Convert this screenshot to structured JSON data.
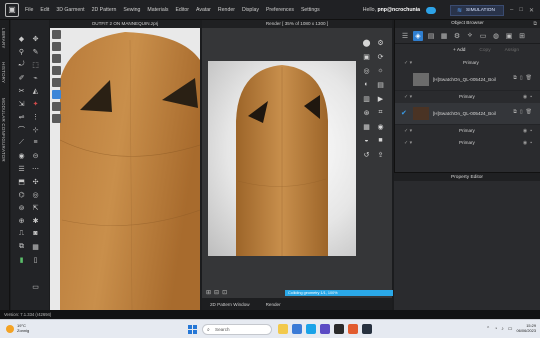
{
  "menubar": {
    "items": [
      "File",
      "Edit",
      "3D Garment",
      "2D Pattern",
      "Sewing",
      "Materials",
      "Editor",
      "Avatar",
      "Render",
      "Display",
      "Preferences",
      "Settings"
    ],
    "greeting_prefix": "Hello, ",
    "username": "pnp@ncrochunia",
    "simulation_label": "SIMULATION"
  },
  "side_tabs": [
    "LIBRARY",
    "HISTORY",
    "MODULAR CONFIGURATOR"
  ],
  "viewport3d": {
    "title": "OUTFIT 2 ON MANNEQUIN.zprj"
  },
  "render": {
    "title": "Render [ 35% of 1080 x 1300 ]",
    "progress_text": "Colliding geometry 1/1, 100%",
    "tabs": [
      "2D Pattern Window",
      "Render"
    ]
  },
  "object_browser": {
    "title": "Object Browser",
    "add_label": "+ Add",
    "copy_label": "Copy",
    "assign_label": "Assign",
    "rows": [
      {
        "kind": "text",
        "label": "Primary",
        "indent": 1
      },
      {
        "kind": "swatch",
        "name": "[H]SwatchOn_QL-005424_Boil",
        "selected": false,
        "color": "#6b6b6b"
      },
      {
        "kind": "text",
        "label": "Primary",
        "indent": 2
      },
      {
        "kind": "swatch",
        "name": "[H]SwatchOn_QL-005424_Boil",
        "selected": true,
        "color": "#4a3324"
      },
      {
        "kind": "text",
        "label": "Primary",
        "indent": 2
      },
      {
        "kind": "text",
        "label": "Primary",
        "indent": 2
      }
    ]
  },
  "property_editor": {
    "title": "Property Editor"
  },
  "status": {
    "version": "Version: 7.1.334 (r42694)"
  },
  "taskbar": {
    "weather_temp": "19°C",
    "weather_desc": "Zonnig",
    "search_placeholder": "Search",
    "time": "15:29",
    "date": "06/06/2023"
  },
  "colors": {
    "accent": "#2f7fd1",
    "progress": "#2aa8e8",
    "wood_light": "#c58a45",
    "wood_dark": "#8c5a25"
  }
}
